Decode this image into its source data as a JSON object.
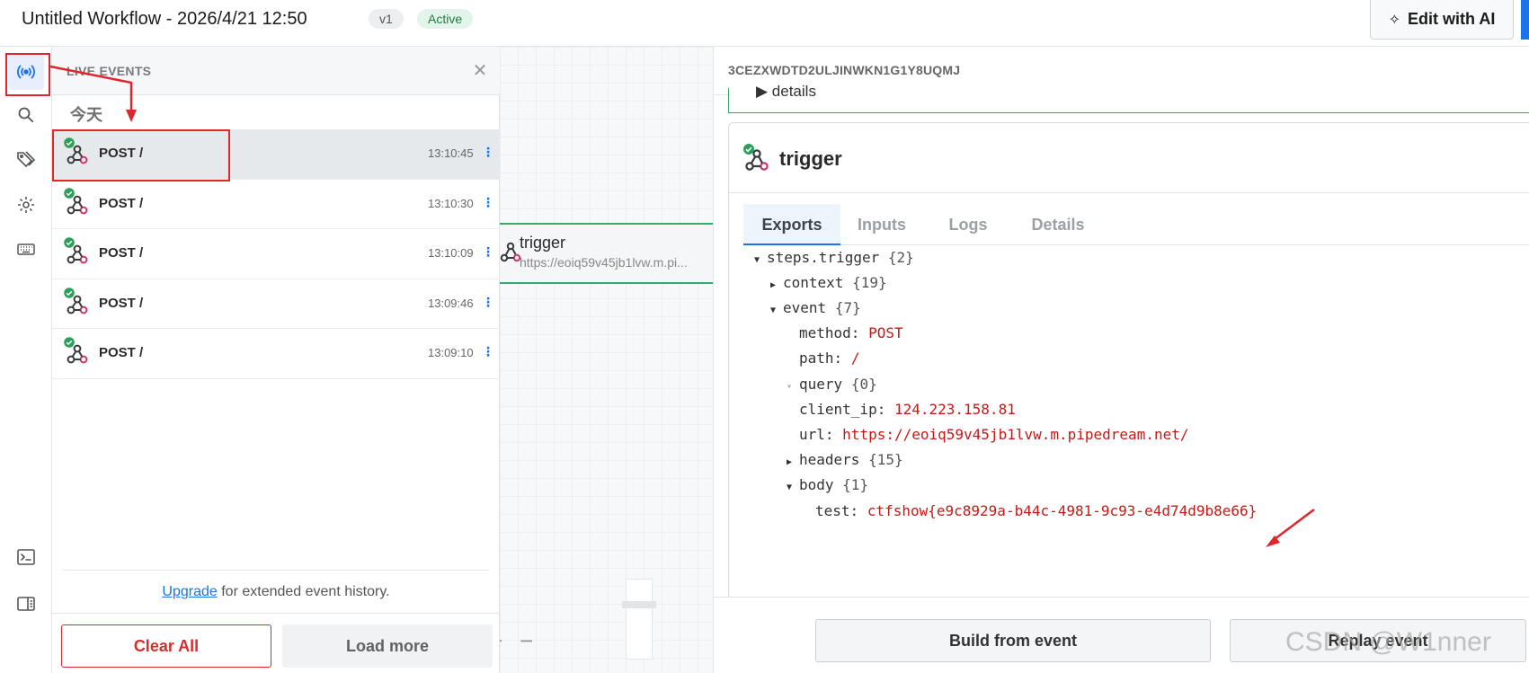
{
  "header": {
    "title": "Untitled Workflow - 2026/4/21 12:50",
    "version": "v1",
    "status": "Active",
    "edit_ai_label": "Edit with AI"
  },
  "rail": {
    "items": [
      "live-events",
      "search",
      "tags",
      "settings",
      "keyboard-shortcuts",
      "terminal",
      "sidebar-toggle"
    ]
  },
  "events_panel": {
    "title": "LIVE EVENTS",
    "day_label": "今天",
    "events": [
      {
        "name": "POST /",
        "time": "13:10:45",
        "selected": true
      },
      {
        "name": "POST /",
        "time": "13:10:30",
        "selected": false
      },
      {
        "name": "POST /",
        "time": "13:10:09",
        "selected": false
      },
      {
        "name": "POST /",
        "time": "13:09:46",
        "selected": false
      },
      {
        "name": "POST /",
        "time": "13:09:10",
        "selected": false
      }
    ],
    "upgrade_link": "Upgrade",
    "upgrade_text": " for extended event history.",
    "clear_all": "Clear All",
    "load_more": "Load more"
  },
  "canvas": {
    "node_title": "trigger",
    "node_url": "https://eoiq59v45jb1lvw.m.pi...",
    "zoom_in": "+",
    "zoom_out": "−"
  },
  "inspector": {
    "event_id": "3CEZXWDTD2ULJINWKN1G1Y8UQMJ",
    "prev_card_text": "details",
    "step_title": "trigger",
    "tabs": [
      "Exports",
      "Inputs",
      "Logs",
      "Details"
    ],
    "active_tab": "Exports",
    "tree": [
      {
        "indent": 0,
        "arrow": "open",
        "key": "steps.trigger",
        "count": "{2}"
      },
      {
        "indent": 1,
        "arrow": "closed",
        "key": "context",
        "count": "{19}"
      },
      {
        "indent": 1,
        "arrow": "open",
        "key": "event",
        "count": "{7}"
      },
      {
        "indent": 2,
        "arrow": "",
        "key": "method:",
        "value": "POST"
      },
      {
        "indent": 2,
        "arrow": "",
        "key": "path:",
        "value": "/"
      },
      {
        "indent": 2,
        "arrow": "empty",
        "key": "query",
        "count": "{0}"
      },
      {
        "indent": 2,
        "arrow": "",
        "key": "client_ip:",
        "value": "124.223.158.81"
      },
      {
        "indent": 2,
        "arrow": "",
        "key": "url:",
        "value": "https://eoiq59v45jb1lvw.m.pipedream.net/"
      },
      {
        "indent": 2,
        "arrow": "closed",
        "key": "headers",
        "count": "{15}"
      },
      {
        "indent": 2,
        "arrow": "open",
        "key": "body",
        "count": "{1}"
      },
      {
        "indent": 3,
        "arrow": "",
        "key": "test:",
        "value": "ctfshow{e9c8929a-b44c-4981-9c93-e4d74d9b8e66}"
      }
    ],
    "build_label": "Build from event",
    "replay_label": "Replay event"
  },
  "watermark": "CSDN @W1nner",
  "colors": {
    "accent": "#1a73e8",
    "success": "#3aa76d",
    "annotation_red": "#e0262c",
    "value_red": "#c41a16"
  }
}
